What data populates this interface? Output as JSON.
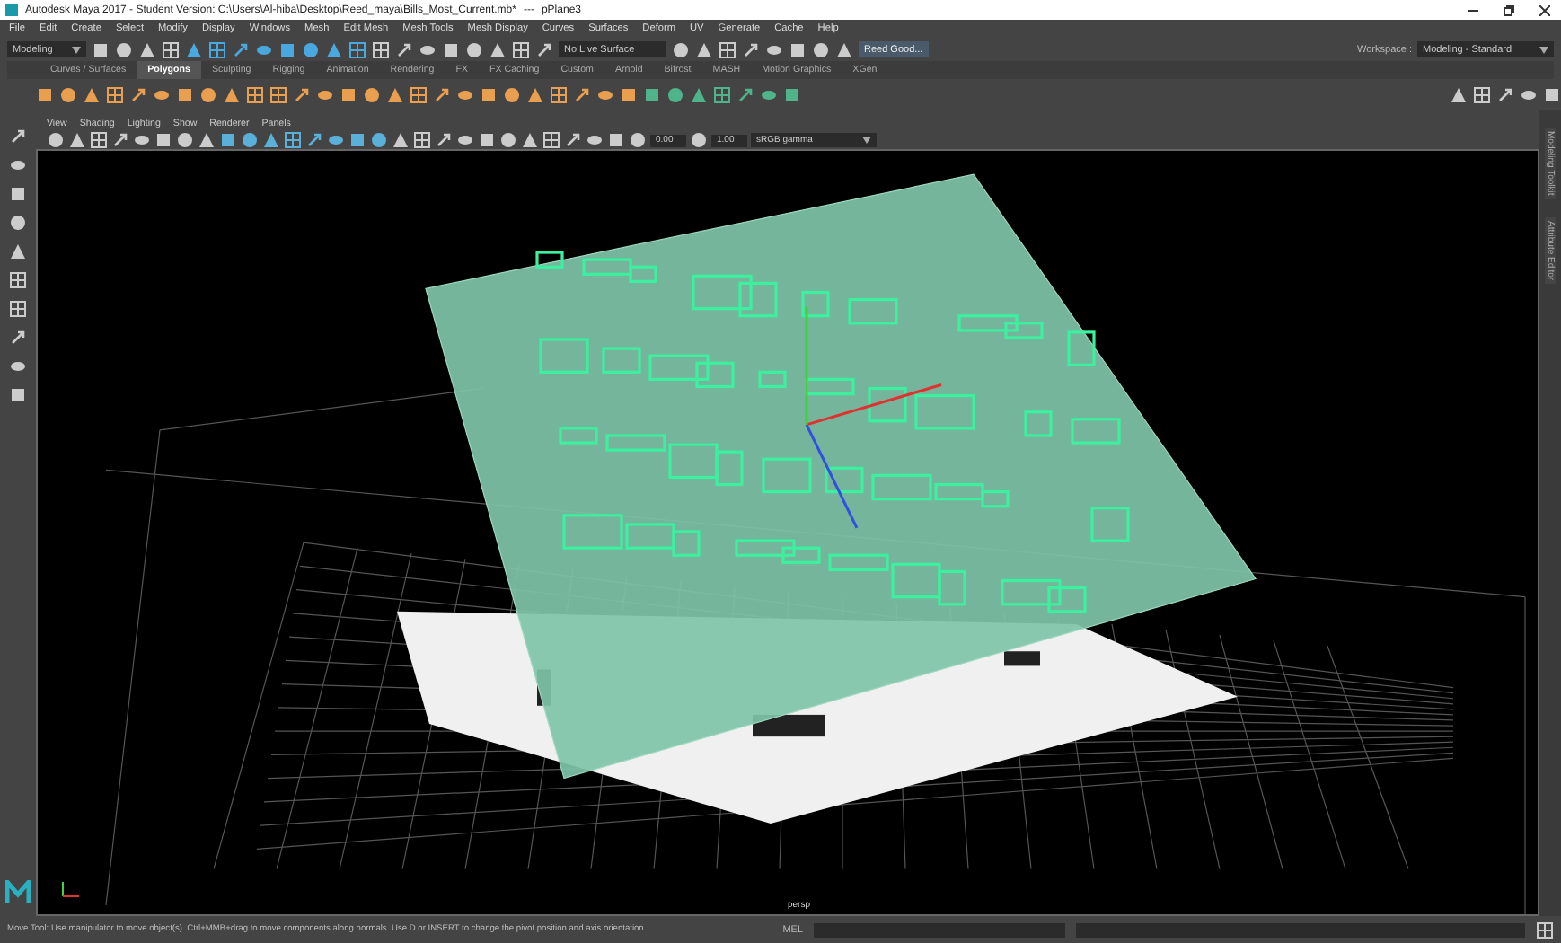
{
  "window": {
    "title": "Autodesk Maya 2017 - Student Version: C:\\Users\\Al-hiba\\Desktop\\Reed_maya\\Bills_Most_Current.mb*",
    "separator": "---",
    "object": "pPlane3"
  },
  "menus": [
    "File",
    "Edit",
    "Create",
    "Select",
    "Modify",
    "Display",
    "Windows",
    "Mesh",
    "Edit Mesh",
    "Mesh Tools",
    "Mesh Display",
    "Curves",
    "Surfaces",
    "Deform",
    "UV",
    "Generate",
    "Cache",
    "Help"
  ],
  "toolbar": {
    "mode": "Modeling",
    "live_surface": "No Live Surface",
    "user": "Reed Good...",
    "workspace_label": "Workspace :",
    "workspace": "Modeling - Standard"
  },
  "shelf_tabs": [
    {
      "label": "Curves / Surfaces",
      "selected": false
    },
    {
      "label": "Polygons",
      "selected": true
    },
    {
      "label": "Sculpting",
      "selected": false
    },
    {
      "label": "Rigging",
      "selected": false
    },
    {
      "label": "Animation",
      "selected": false
    },
    {
      "label": "Rendering",
      "selected": false
    },
    {
      "label": "FX",
      "selected": false
    },
    {
      "label": "FX Caching",
      "selected": false
    },
    {
      "label": "Custom",
      "selected": false
    },
    {
      "label": "Arnold",
      "selected": false
    },
    {
      "label": "Bifrost",
      "selected": false
    },
    {
      "label": "MASH",
      "selected": false
    },
    {
      "label": "Motion Graphics",
      "selected": false
    },
    {
      "label": "XGen",
      "selected": false
    }
  ],
  "panel_menus": [
    "View",
    "Shading",
    "Lighting",
    "Show",
    "Renderer",
    "Panels"
  ],
  "viewport": {
    "exposure": "0.00",
    "gamma": "1.00",
    "color_space": "sRGB gamma",
    "camera": "persp"
  },
  "side_tabs": [
    "Modeling Toolkit",
    "Attribute Editor"
  ],
  "status_bar": {
    "help": "Move Tool: Use manipulator to move object(s). Ctrl+MMB+drag to move components along normals. Use D or INSERT to change the pivot position and axis orientation.",
    "command_label": "MEL"
  }
}
